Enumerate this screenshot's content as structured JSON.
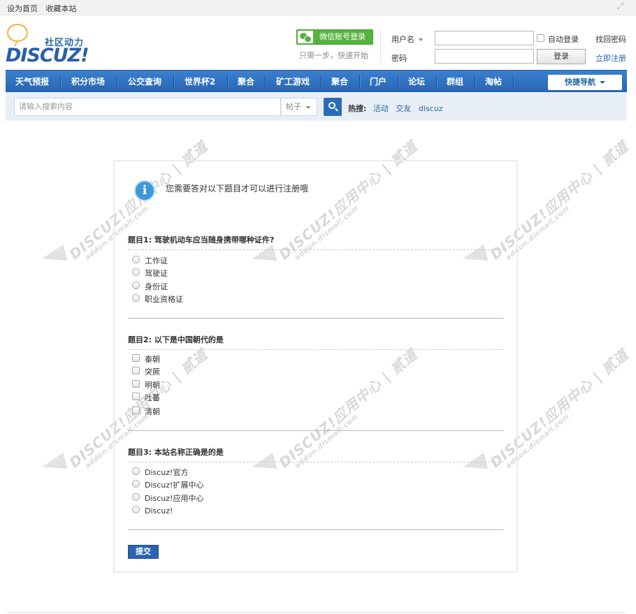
{
  "topbar": {
    "set_home": "设为首页",
    "favorite": "收藏本站",
    "expand_icon": "expand-icon"
  },
  "logo": {
    "slogan": "社区动力",
    "brand": "DISCUZ!"
  },
  "wechat": {
    "button_label": "微信账号登录",
    "tip": "只需一步，快速开始"
  },
  "login": {
    "username_label": "用户名",
    "password_label": "密码",
    "username_value": "",
    "password_value": "",
    "auto_login_label": "自动登录",
    "auto_login_checked": false,
    "login_button": "登录",
    "forgot_password": "找回密码",
    "register": "立即注册"
  },
  "nav": {
    "items": [
      "天气预报",
      "积分市场",
      "公交查询",
      "世界杯2",
      "聚合",
      "矿工游戏",
      "聚合",
      "门户",
      "论坛",
      "群组",
      "淘帖"
    ],
    "quick_nav": "快捷导航"
  },
  "search": {
    "placeholder": "请输入搜索内容",
    "type": "帖子",
    "hot_label": "热搜:",
    "hot_keywords": [
      "活动",
      "交友",
      "discuz"
    ]
  },
  "watermark": {
    "line1": "DISCUZ!应用中心 | 贰道",
    "line2": "addon.dismall.com"
  },
  "panel": {
    "notice": "您需要答对以下题目才可以进行注册哦",
    "questions": [
      {
        "title": "题目1: 驾驶机动车应当随身携带哪种证件?",
        "input": "radio",
        "options": [
          "工作证",
          "驾驶证",
          "身份证",
          "职业资格证"
        ]
      },
      {
        "title": "题目2: 以下是中国朝代的是",
        "input": "checkbox",
        "options": [
          "秦朝",
          "突厥",
          "明朝",
          "吐蕃",
          "清朝"
        ]
      },
      {
        "title": "题目3: 本站名称正确是的是",
        "input": "radio",
        "options": [
          "Discuz!官方",
          "Discuz!扩展中心",
          "Discuz!应用中心",
          "Discuz!"
        ]
      }
    ],
    "submit": "提交"
  },
  "colors": {
    "nav_bg": "#2b6cb8",
    "accent_link": "#2366a8",
    "wechat_green": "#57b33f",
    "search_bar_bg": "#e8eff6"
  }
}
